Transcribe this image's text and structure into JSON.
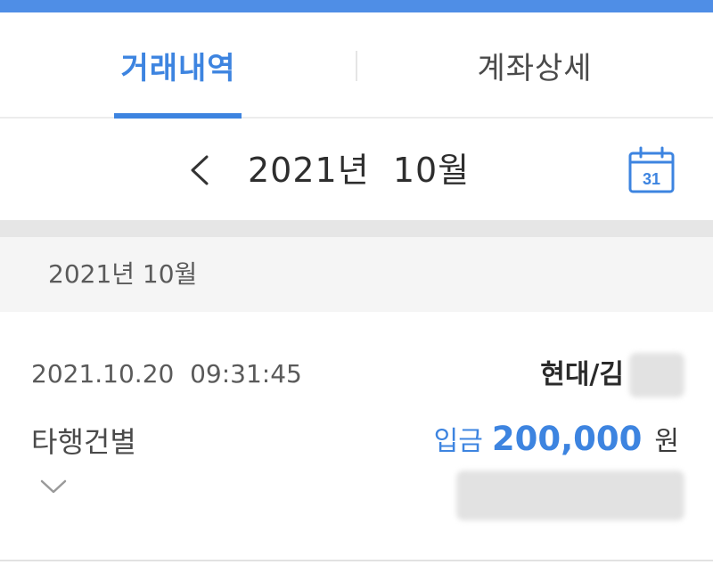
{
  "colors": {
    "accent": "#3d84e0",
    "topbar": "#4f8ee6"
  },
  "tabs": [
    {
      "label": "거래내역",
      "active": true
    },
    {
      "label": "계좌상세",
      "active": false
    }
  ],
  "month_nav": {
    "label": "2021년  10월",
    "prev_icon": "chevron-left-icon",
    "calendar_icon": "calendar-icon",
    "calendar_day": "31"
  },
  "section": {
    "header": "2021년 10월"
  },
  "transactions": [
    {
      "datetime": "2021.10.20  09:31:45",
      "counterparty": "현대/김",
      "type": "타행건별",
      "kind": "입금",
      "amount": "200,000",
      "unit": "원",
      "expand_icon": "chevron-down-icon"
    }
  ]
}
